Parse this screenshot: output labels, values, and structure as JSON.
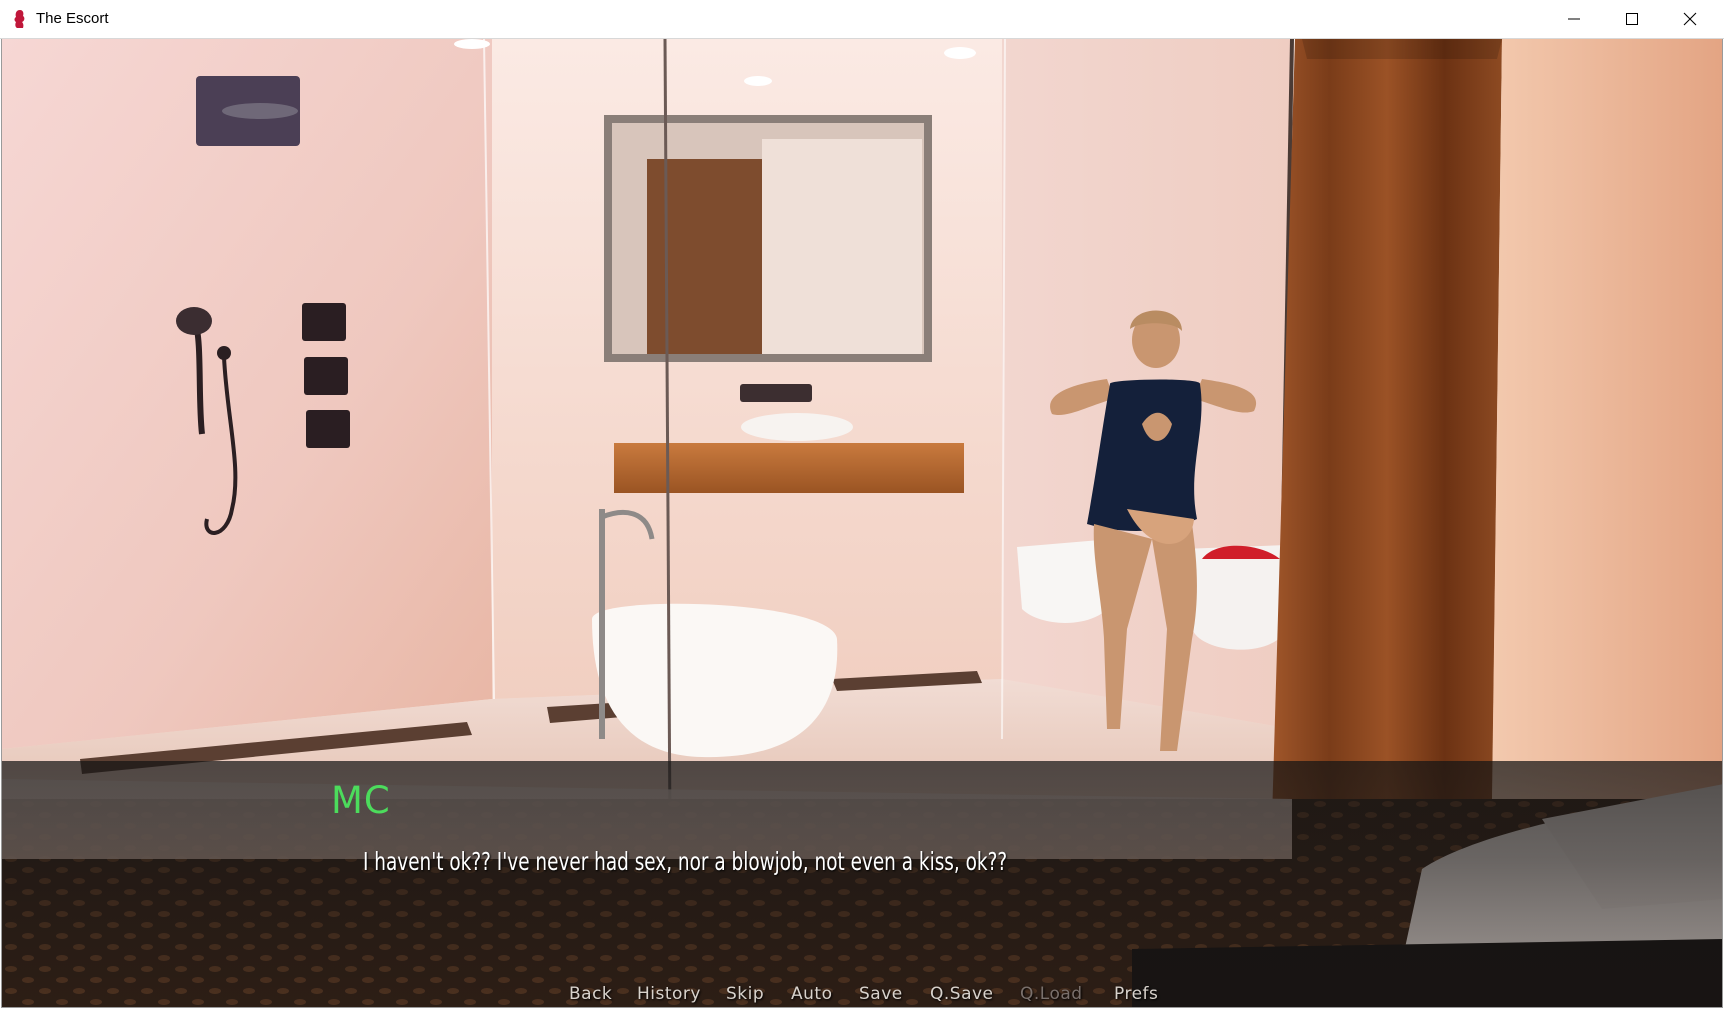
{
  "window": {
    "title": "The Escort",
    "app_icon": "escort-app-icon",
    "controls": [
      "minimize-icon",
      "maximize-icon",
      "close-icon"
    ]
  },
  "dialogue": {
    "speaker": "MC",
    "speaker_color": "#4cdc5c",
    "text": "I haven't ok?? I've never had sex, nor a blowjob, not even a kiss, ok??"
  },
  "quick_menu": {
    "back": "Back",
    "history": "History",
    "skip": "Skip",
    "auto": "Auto",
    "save": "Save",
    "qsave": "Q.Save",
    "qload": "Q.Load",
    "prefs": "Prefs"
  }
}
